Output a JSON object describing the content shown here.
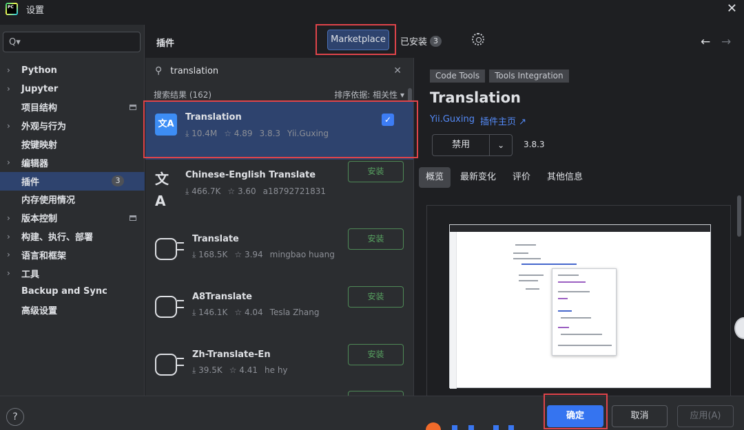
{
  "window": {
    "title": "设置",
    "logo_text": "PC"
  },
  "sidebar": {
    "search_placeholder": "Q▾",
    "items": [
      {
        "label": "Python",
        "chevron": true
      },
      {
        "label": "Jupyter",
        "chevron": true
      },
      {
        "label": "项目结构",
        "chevron": false,
        "project_icon": true
      },
      {
        "label": "外观与行为",
        "chevron": true
      },
      {
        "label": "按键映射",
        "chevron": false
      },
      {
        "label": "编辑器",
        "chevron": true
      },
      {
        "label": "插件",
        "chevron": false,
        "selected": true,
        "badge": "3"
      },
      {
        "label": "内存使用情况",
        "chevron": false
      },
      {
        "label": "版本控制",
        "chevron": true,
        "project_icon": true
      },
      {
        "label": "构建、执行、部署",
        "chevron": true
      },
      {
        "label": "语言和框架",
        "chevron": true
      },
      {
        "label": "工具",
        "chevron": true
      },
      {
        "label": "Backup and Sync",
        "chevron": false
      },
      {
        "label": "高级设置",
        "chevron": false
      }
    ]
  },
  "header": {
    "section_title": "插件",
    "tab_marketplace": "Marketplace",
    "tab_installed": "已安装",
    "installed_count": "3"
  },
  "list": {
    "search_value": "translation",
    "results_label": "搜索结果 (162)",
    "sort_label": "排序依据: 相关性 ▾",
    "plugins": [
      {
        "name": "Translation",
        "downloads": "10.4M",
        "rating": "4.89",
        "version": "3.8.3",
        "vendor": "Yii.Guxing",
        "icon": "translation-icon",
        "installed": true
      },
      {
        "name": "Chinese-English Translate",
        "downloads": "466.7K",
        "rating": "3.60",
        "version": "",
        "vendor": "a18792721831",
        "icon": "zh-translate-icon",
        "install_label": "安装"
      },
      {
        "name": "Translate",
        "downloads": "168.5K",
        "rating": "3.94",
        "version": "",
        "vendor": "mingbao huang",
        "icon": "plugin-icon",
        "install_label": "安装"
      },
      {
        "name": "A8Translate",
        "downloads": "146.1K",
        "rating": "4.04",
        "version": "",
        "vendor": "Tesla Zhang",
        "icon": "plugin-icon",
        "install_label": "安装"
      },
      {
        "name": "Zh-Translate-En",
        "downloads": "39.5K",
        "rating": "4.41",
        "version": "",
        "vendor": "he hy",
        "icon": "plugin-icon",
        "install_label": "安装"
      }
    ]
  },
  "detail": {
    "tags": [
      "Code Tools",
      "Tools Integration"
    ],
    "title": "Translation",
    "vendor": "Yii.Guxing",
    "homepage_label": "插件主页 ↗",
    "disable_label": "禁用",
    "version": "3.8.3",
    "tabs": [
      "概览",
      "最新变化",
      "评价",
      "其他信息"
    ],
    "active_tab": "概览"
  },
  "footer": {
    "help": "?",
    "ok_label": "确定",
    "cancel_label": "取消",
    "apply_label": "应用(A)"
  },
  "colors": {
    "accent": "#3574f0",
    "selection": "#2e436e",
    "install_green": "#58a361",
    "highlight_red": "#e0444a",
    "link_blue": "#548af7"
  }
}
